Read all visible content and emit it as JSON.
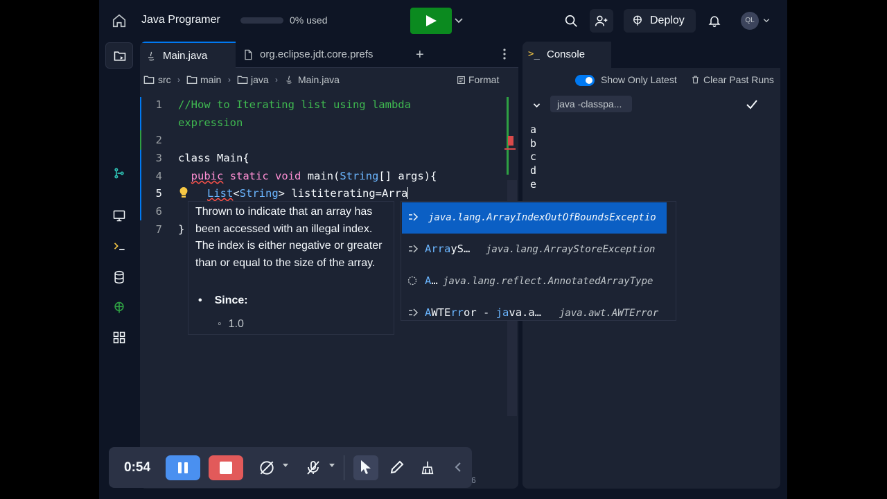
{
  "header": {
    "title": "Java Programer",
    "usage_text": "0% used",
    "usage_fraction": 0,
    "deploy_label": "Deploy",
    "avatar_initials": "QL"
  },
  "editor": {
    "tabs": [
      {
        "label": "Main.java",
        "active": true
      },
      {
        "label": "org.eclipse.jdt.core.prefs",
        "active": false
      }
    ],
    "breadcrumb": [
      "src",
      "main",
      "java",
      "Main.java"
    ],
    "format_label": "Format",
    "line_numbers": [
      "1",
      "2",
      "3",
      "4",
      "5",
      "6",
      "7"
    ],
    "code": {
      "l1a": "//How to Iterating list using lambda",
      "l1b": "expression",
      "l3_kw": "class",
      "l3_rest": " Main{",
      "l4_indent": "  ",
      "l4_pubic": "pubic",
      "l4_static": "static",
      "l4_void": "void",
      "l4_main": "main(",
      "l4_type": "String",
      "l4_rest": "[] args){",
      "l5_list": "List",
      "l5_lt": "<",
      "l5_type": "String",
      "l5_rest": "> listiterating=Arra",
      "l7": "}"
    }
  },
  "doc_tooltip": {
    "text": "Thrown to indicate that an array has been accessed with an illegal index. The index is either negative or greater than or equal to the size of the array.",
    "since_label": "Since:",
    "since_version": "1.0"
  },
  "suggestions": [
    {
      "name": "",
      "detail": "java.lang.ArrayIndexOutOfBoundsExceptio",
      "selected": true
    },
    {
      "name_hl": "Arra",
      "name_rest": "yS…",
      "detail": "java.lang.ArrayStoreException"
    },
    {
      "name_hl": "A",
      "name_rest": "…",
      "detail": "java.lang.reflect.AnnotatedArrayType"
    },
    {
      "name_hl": "A",
      "name_rest": "WTE",
      "name_hl2": "rr",
      "name_rest2": "or - ",
      "name_hl3": "ja",
      "name_rest3": "va.a…",
      "detail": "java.awt.AWTError"
    }
  ],
  "console": {
    "tab_label": "Console",
    "show_latest_label": "Show Only Latest",
    "clear_label": "Clear Past Runs",
    "run_command": "java -classpa...",
    "output": [
      "a",
      "b",
      "c",
      "d",
      "e"
    ]
  },
  "recorder": {
    "time": "0:54"
  },
  "bottom_hint": "6",
  "colors": {
    "app_bg": "#0e1525",
    "panel_bg": "#1c2333",
    "accent": "#0079f2",
    "run_green": "#0b8a1f",
    "comment_green": "#3fb950"
  },
  "icons": [
    "home-icon",
    "play-icon",
    "search-icon",
    "invite-icon",
    "deploy-icon",
    "bell-icon",
    "files-icon",
    "git-icon",
    "preview-icon",
    "shell-icon",
    "database-icon",
    "deployments-icon",
    "apps-icon",
    "java-icon",
    "gear-icon",
    "folder-icon",
    "lightbulb-icon",
    "class-icon",
    "trash-icon",
    "check-icon",
    "pen-icon",
    "broom-icon",
    "cursor-icon",
    "mic-off-icon",
    "camera-off-icon"
  ]
}
